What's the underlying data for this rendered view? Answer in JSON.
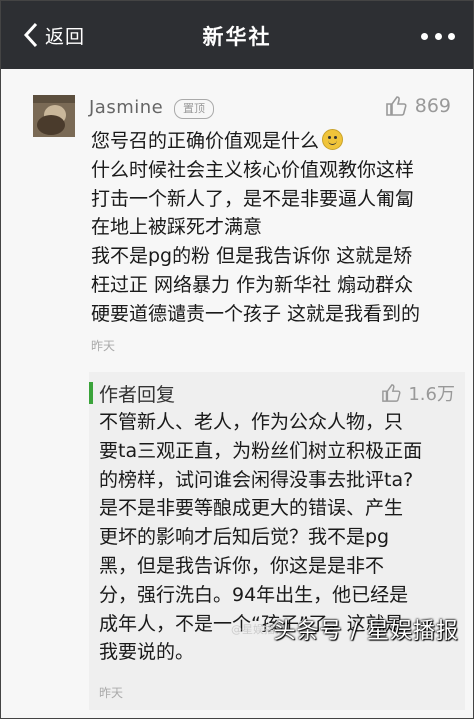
{
  "nav": {
    "back_label": "返回",
    "title": "新华社"
  },
  "comment": {
    "username": "Jasmine",
    "badge": "置顶",
    "likes": "869",
    "lines": [
      "您号召的正确价值观是什么",
      "什么时候社会主义核心价值观教你这样",
      "打击一个新人了，是不是非要逼人匍匐",
      "在地上被踩死才满意",
      "我不是pg的粉 但是我告诉你 这就是矫",
      "枉过正 网络暴力 作为新华社 煽动群众",
      "硬要道德谴责一个孩子 这就是我看到的"
    ],
    "time": "昨天"
  },
  "reply": {
    "label": "作者回复",
    "likes": "1.6万",
    "lines": [
      "不管新人、老人，作为公众人物，只",
      "要ta三观正直，为粉丝们树立积极正面",
      "的榜样，试问谁会闲得没事去批评ta?",
      "是不是非要等酿成更大的错误、产生",
      "更坏的影响才后知后觉？我不是pg",
      "黑，但是我告诉你，你这是是非不",
      "分，强行洗白。94年出生，他已经是",
      "成年人，不是一个“孩子”了。这就是",
      "我要说的。"
    ],
    "time": "昨天"
  },
  "watermark": {
    "text": "头条号 / 星娱播报",
    "small": "@星娱播报"
  },
  "colors": {
    "navbar": "#2d2f33",
    "reply_accent": "#3aa33a"
  }
}
